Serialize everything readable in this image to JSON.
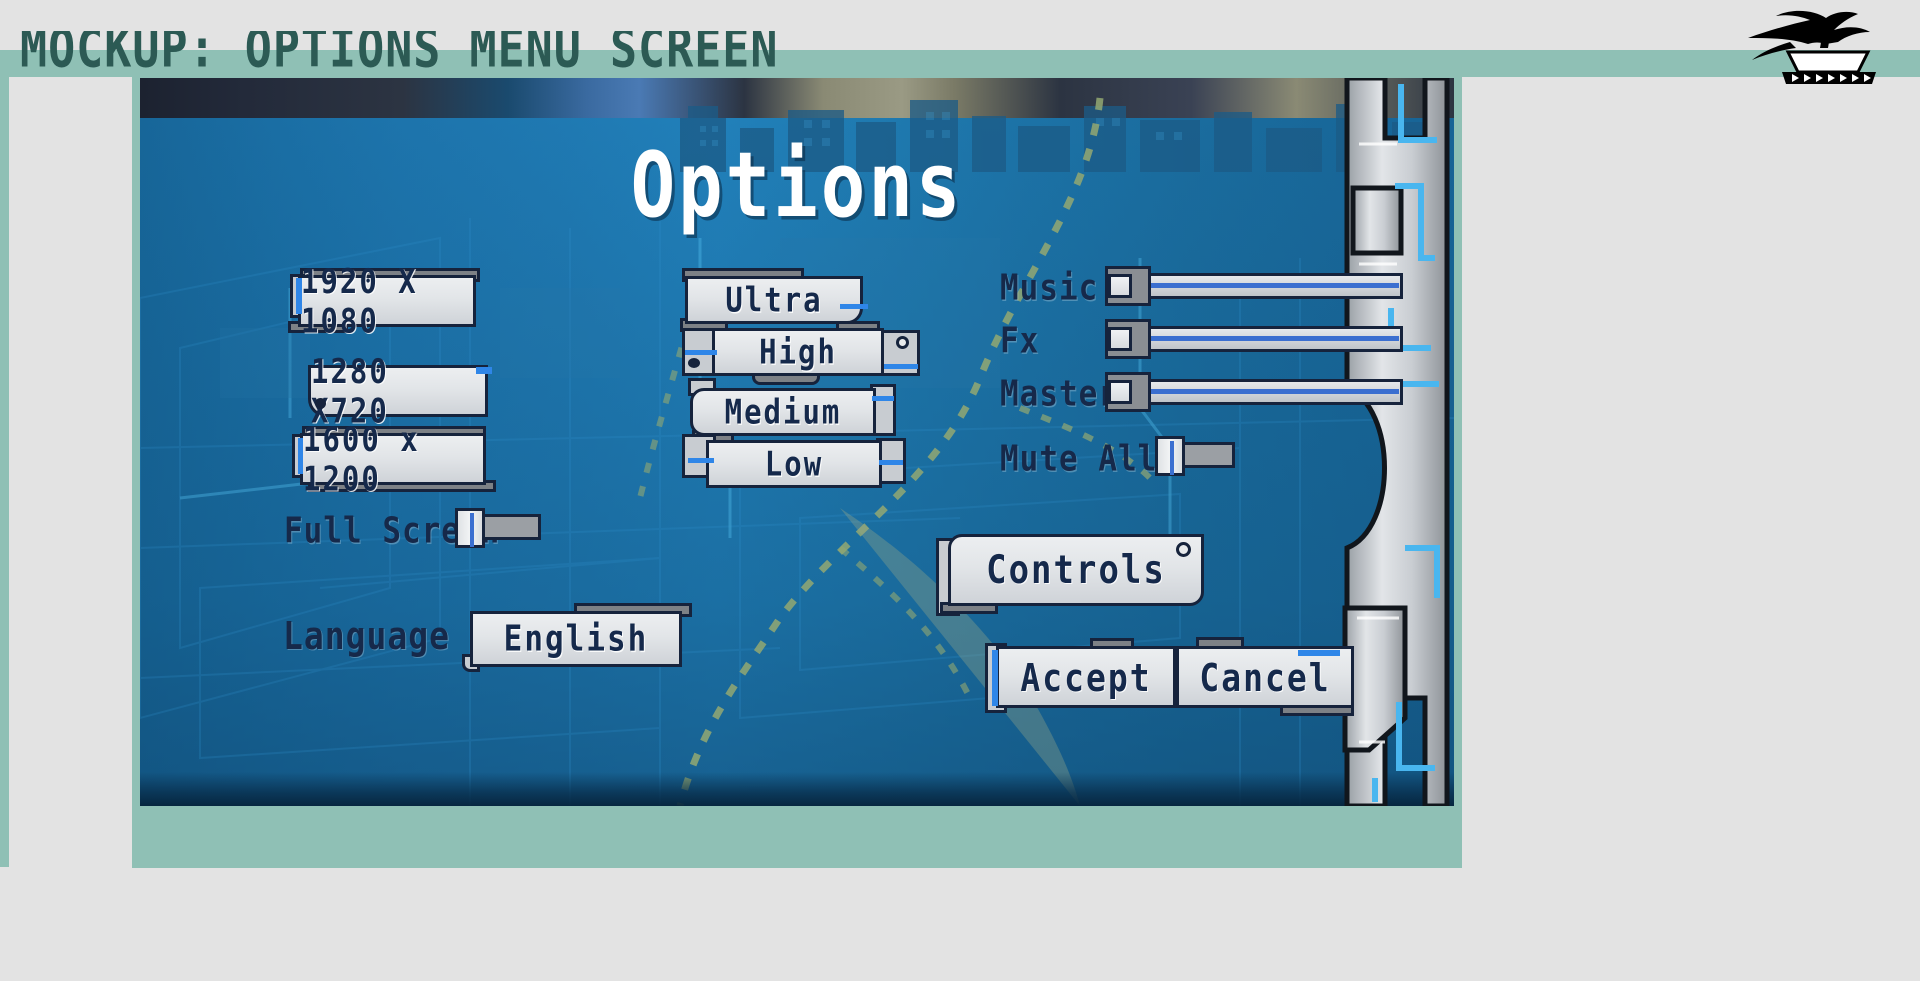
{
  "mockup": {
    "title": "MOCKUP: OPTIONS MENU SCREEN",
    "band_color": "#8fc0b5",
    "title_color": "#2c5a54",
    "page_bg": "#e3e3e3"
  },
  "logo": {
    "name": "bonsai-tree-logo"
  },
  "screen": {
    "title": "Options",
    "title_color": "#ffffff",
    "panel_bg": "#1f79b2",
    "accent_cyan": "#2f86e8",
    "button_face": "#e6e9ec",
    "button_text": "#15294b"
  },
  "resolution": {
    "options": [
      {
        "label": "1920 X 1080",
        "selected": true
      },
      {
        "label": "1280 X720",
        "selected": false
      },
      {
        "label": "1600 x 1200",
        "selected": false
      }
    ]
  },
  "quality": {
    "options": [
      {
        "label": "Ultra"
      },
      {
        "label": "High"
      },
      {
        "label": "Medium"
      },
      {
        "label": "Low"
      }
    ]
  },
  "fullscreen": {
    "label": "Full Screen",
    "state": "off"
  },
  "language": {
    "label": "Language",
    "value": "English"
  },
  "audio": {
    "sliders": [
      {
        "label": "Music",
        "value": 0
      },
      {
        "label": "Fx",
        "value": 0
      },
      {
        "label": "Master",
        "value": 0
      }
    ],
    "mute": {
      "label": "Mute All",
      "state": "off"
    }
  },
  "actions": {
    "controls": "Controls",
    "accept": "Accept",
    "cancel": "Cancel"
  }
}
